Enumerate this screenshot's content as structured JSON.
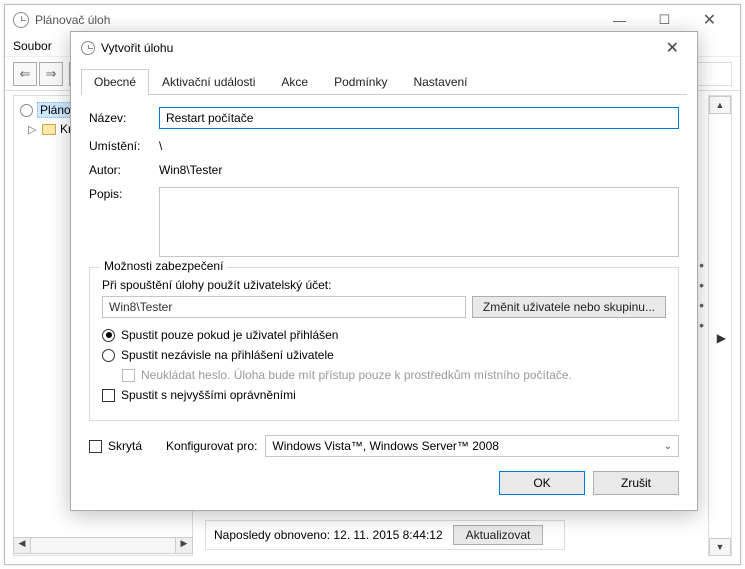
{
  "main": {
    "title": "Plánovač úloh",
    "menu": {
      "file": "Soubor"
    },
    "tree": {
      "root": "Plánov",
      "child": "Kn"
    },
    "status": {
      "text": "Naposledy obnoveno: 12. 11. 2015 8:44:12",
      "refresh": "Aktualizovat"
    }
  },
  "dialog": {
    "title": "Vytvořit úlohu",
    "tabs": {
      "general": "Obecné",
      "triggers": "Aktivační události",
      "actions": "Akce",
      "conditions": "Podmínky",
      "settings": "Nastavení"
    },
    "general": {
      "name_label": "Název:",
      "name_value": "Restart počítače",
      "location_label": "Umístění:",
      "location_value": "\\",
      "author_label": "Autor:",
      "author_value": "Win8\\Tester",
      "desc_label": "Popis:",
      "desc_value": ""
    },
    "security": {
      "group_label": "Možnosti zabezpečení",
      "run_as_label": "Při spouštění úlohy použít uživatelský účet:",
      "user": "Win8\\Tester",
      "change_btn": "Změnit uživatele nebo skupinu...",
      "radio_loggedon": "Spustit pouze pokud je uživatel přihlášen",
      "radio_any": "Spustit nezávisle na přihlášení uživatele",
      "no_store": "Neukládat heslo.  Úloha bude mít přístup pouze k prostředkům místního počítače.",
      "highest": "Spustit s nejvyššími oprávněními"
    },
    "footer": {
      "hidden": "Skrytá",
      "configure_label": "Konfigurovat pro:",
      "configure_value": "Windows Vista™, Windows Server™ 2008",
      "ok": "OK",
      "cancel": "Zrušit"
    }
  }
}
